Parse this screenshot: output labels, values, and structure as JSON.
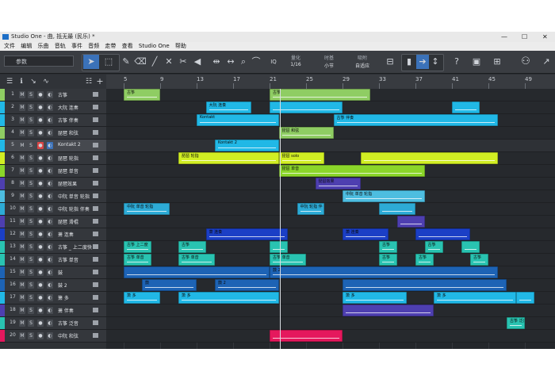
{
  "window": {
    "title": "Studio One - 曲, 抵无最 (民乐) *",
    "controls": [
      "—",
      "☐",
      "✕"
    ]
  },
  "menu": [
    "文件",
    "编辑",
    "乐曲",
    "音轨",
    "事件",
    "音频",
    "走带",
    "查看",
    "Studio One",
    "帮助"
  ],
  "toolbar": {
    "param_label": "参数",
    "quantize_label": "IQ",
    "quantize_name": "量化",
    "quantize_value": "1/16",
    "timebase_name": "时基",
    "timebase_value": "小节",
    "snap_name": "吸附",
    "snap_value": "自适应",
    "help_label": "?",
    "icons": [
      "arrow-tool-icon",
      "range-tool-icon",
      "pencil-tool-icon",
      "eraser-tool-icon",
      "paint-tool-icon",
      "mute-tool-icon",
      "split-tool-icon",
      "listen-tool-icon",
      "bend-tool-icon",
      "stretch-tool-icon",
      "zoom-tool-icon",
      "speaker-tool-icon",
      "snap-icon",
      "follow-icon",
      "cursor-icon",
      "help-icon",
      "video-icon",
      "grid-view-icon",
      "person-icon",
      "browse-icon"
    ]
  },
  "ruler": {
    "bars": [
      "5",
      "9",
      "13",
      "17",
      "21",
      "25",
      "29",
      "33",
      "37",
      "41",
      "45",
      "49"
    ]
  },
  "tracks": [
    {
      "num": "1",
      "name": "古筝",
      "color": "#8fcd63"
    },
    {
      "num": "2",
      "name": "大阮 连奏",
      "color": "#21b8e6"
    },
    {
      "num": "3",
      "name": "古筝 伴奏",
      "color": "#21b8e6"
    },
    {
      "num": "4",
      "name": "琵琶 和弦",
      "color": "#8fcd63"
    },
    {
      "num": "5",
      "name": "Kontakt 2",
      "color": "#21b8e6"
    },
    {
      "num": "6",
      "name": "琵琶 轮指",
      "color": "#d1ee23"
    },
    {
      "num": "7",
      "name": "琵琶 单音",
      "color": "#8bd62a"
    },
    {
      "num": "8",
      "name": "琵琶效果",
      "color": "#4e3fb0"
    },
    {
      "num": "9",
      "name": "中阮 单音 轮指",
      "color": "#4dbde0"
    },
    {
      "num": "10",
      "name": "中阮 轮指 伴奏",
      "color": "#2dabd6"
    },
    {
      "num": "11",
      "name": "琵琶 滑棍",
      "color": "#4e3fb0"
    },
    {
      "num": "12",
      "name": "萧 连奏",
      "color": "#1b3fc6"
    },
    {
      "num": "13",
      "name": "古筝 _ 上二度快",
      "color": "#29c3b1"
    },
    {
      "num": "14",
      "name": "古筝 单音",
      "color": "#29c3b1"
    },
    {
      "num": "15",
      "name": "鼓",
      "color": "#1d63b5"
    },
    {
      "num": "16",
      "name": "鼓 2",
      "color": "#1d63b5"
    },
    {
      "num": "17",
      "name": "箫 多",
      "color": "#21b8e6"
    },
    {
      "num": "18",
      "name": "萧 伴奏",
      "color": "#4e3fb0"
    },
    {
      "num": "19",
      "name": "古筝 泛音",
      "color": "#29c3b1"
    },
    {
      "num": "20",
      "name": "中阮 和弦",
      "color": "#e5185d"
    }
  ],
  "track_buttons": {
    "mute": "M",
    "solo": "S",
    "rec": "●",
    "mon": "◐"
  },
  "selected_track_index": "4",
  "clips": [
    {
      "track": 0,
      "bar": 5,
      "len": 4,
      "label": "古筝",
      "color": "#8fcd63"
    },
    {
      "track": 0,
      "bar": 21,
      "len": 11,
      "label": "古筝",
      "color": "#8fcd63"
    },
    {
      "track": 1,
      "bar": 14,
      "len": 5,
      "label": "大阮 连奏",
      "color": "#21b8e6"
    },
    {
      "track": 1,
      "bar": 21,
      "len": 8,
      "label": "",
      "color": "#21b8e6"
    },
    {
      "track": 1,
      "bar": 41,
      "len": 3,
      "label": "",
      "color": "#21b8e6"
    },
    {
      "track": 2,
      "bar": 13,
      "len": 9,
      "label": "Kontakt",
      "color": "#21b8e6"
    },
    {
      "track": 2,
      "bar": 28,
      "len": 18,
      "label": "古筝 伴奏",
      "color": "#21b8e6"
    },
    {
      "track": 3,
      "bar": 22,
      "len": 6,
      "label": "琵琶 和弦",
      "color": "#8fcd63"
    },
    {
      "track": 4,
      "bar": 15,
      "len": 7,
      "label": "Kontakt 2",
      "color": "#21b8e6"
    },
    {
      "track": 5,
      "bar": 11,
      "len": 11,
      "label": "琵琶 轮指",
      "color": "#d1ee23"
    },
    {
      "track": 5,
      "bar": 22,
      "len": 5,
      "label": "琵琶 solo",
      "color": "#d1ee23"
    },
    {
      "track": 5,
      "bar": 31,
      "len": 15,
      "label": "",
      "color": "#d1ee23"
    },
    {
      "track": 6,
      "bar": 22,
      "len": 16,
      "label": "琵琶 单音",
      "color": "#8bd62a"
    },
    {
      "track": 7,
      "bar": 26,
      "len": 5,
      "label": "琵琶效果",
      "color": "#4e3fb0"
    },
    {
      "track": 8,
      "bar": 29,
      "len": 9,
      "label": "中阮 单音 轮指",
      "color": "#4dbde0"
    },
    {
      "track": 9,
      "bar": 5,
      "len": 5,
      "label": "中阮 单音 轮指",
      "color": "#2dabd6"
    },
    {
      "track": 9,
      "bar": 24,
      "len": 3,
      "label": "中阮 轮指 伴",
      "color": "#2dabd6"
    },
    {
      "track": 9,
      "bar": 33,
      "len": 4,
      "label": "",
      "color": "#2dabd6"
    },
    {
      "track": 10,
      "bar": 35,
      "len": 3,
      "label": "",
      "color": "#4e3fb0"
    },
    {
      "track": 11,
      "bar": 14,
      "len": 9,
      "label": "萧 连奏",
      "color": "#1b3fc6"
    },
    {
      "track": 11,
      "bar": 29,
      "len": 5,
      "label": "萧 连奏",
      "color": "#1b3fc6"
    },
    {
      "track": 11,
      "bar": 37,
      "len": 6,
      "label": "",
      "color": "#1b3fc6"
    },
    {
      "track": 12,
      "bar": 5,
      "len": 3,
      "label": "古筝 上二度",
      "color": "#29c3b1"
    },
    {
      "track": 12,
      "bar": 11,
      "len": 3,
      "label": "古筝",
      "color": "#29c3b1"
    },
    {
      "track": 12,
      "bar": 21,
      "len": 2,
      "label": "",
      "color": "#29c3b1"
    },
    {
      "track": 12,
      "bar": 33,
      "len": 2,
      "label": "古筝",
      "color": "#29c3b1"
    },
    {
      "track": 12,
      "bar": 38,
      "len": 2,
      "label": "古筝",
      "color": "#29c3b1"
    },
    {
      "track": 12,
      "bar": 42,
      "len": 2,
      "label": "",
      "color": "#29c3b1"
    },
    {
      "track": 13,
      "bar": 5,
      "len": 3,
      "label": "古筝 单音",
      "color": "#29c3b1"
    },
    {
      "track": 13,
      "bar": 11,
      "len": 4,
      "label": "古筝 单音",
      "color": "#29c3b1"
    },
    {
      "track": 13,
      "bar": 21,
      "len": 4,
      "label": "古筝 单音",
      "color": "#29c3b1"
    },
    {
      "track": 13,
      "bar": 33,
      "len": 2,
      "label": "古筝",
      "color": "#29c3b1"
    },
    {
      "track": 13,
      "bar": 37,
      "len": 2,
      "label": "古筝",
      "color": "#29c3b1"
    },
    {
      "track": 13,
      "bar": 43,
      "len": 2,
      "label": "古筝",
      "color": "#29c3b1"
    },
    {
      "track": 14,
      "bar": 5,
      "len": 16,
      "label": "",
      "color": "#1d63b5"
    },
    {
      "track": 14,
      "bar": 21,
      "len": 25,
      "label": "鼓 2",
      "color": "#1d63b5"
    },
    {
      "track": 15,
      "bar": 7,
      "len": 6,
      "label": "鼓",
      "color": "#1d63b5"
    },
    {
      "track": 15,
      "bar": 15,
      "len": 7,
      "label": "鼓 2",
      "color": "#1d63b5"
    },
    {
      "track": 15,
      "bar": 29,
      "len": 18,
      "label": "",
      "color": "#1d63b5"
    },
    {
      "track": 16,
      "bar": 5,
      "len": 4,
      "label": "箫 多",
      "color": "#21b8e6"
    },
    {
      "track": 16,
      "bar": 11,
      "len": 11,
      "label": "箫 多",
      "color": "#21b8e6"
    },
    {
      "track": 16,
      "bar": 29,
      "len": 7,
      "label": "箫 多",
      "color": "#21b8e6"
    },
    {
      "track": 16,
      "bar": 39,
      "len": 9,
      "label": "箫 多",
      "color": "#21b8e6"
    },
    {
      "track": 16,
      "bar": 48,
      "len": 2,
      "label": "",
      "color": "#21b8e6"
    },
    {
      "track": 17,
      "bar": 29,
      "len": 10,
      "label": "",
      "color": "#4e3fb0"
    },
    {
      "track": 18,
      "bar": 47,
      "len": 2,
      "label": "古筝 泛音",
      "color": "#29c3b1"
    },
    {
      "track": 19,
      "bar": 21,
      "len": 8,
      "label": "",
      "color": "#e5185d"
    }
  ]
}
